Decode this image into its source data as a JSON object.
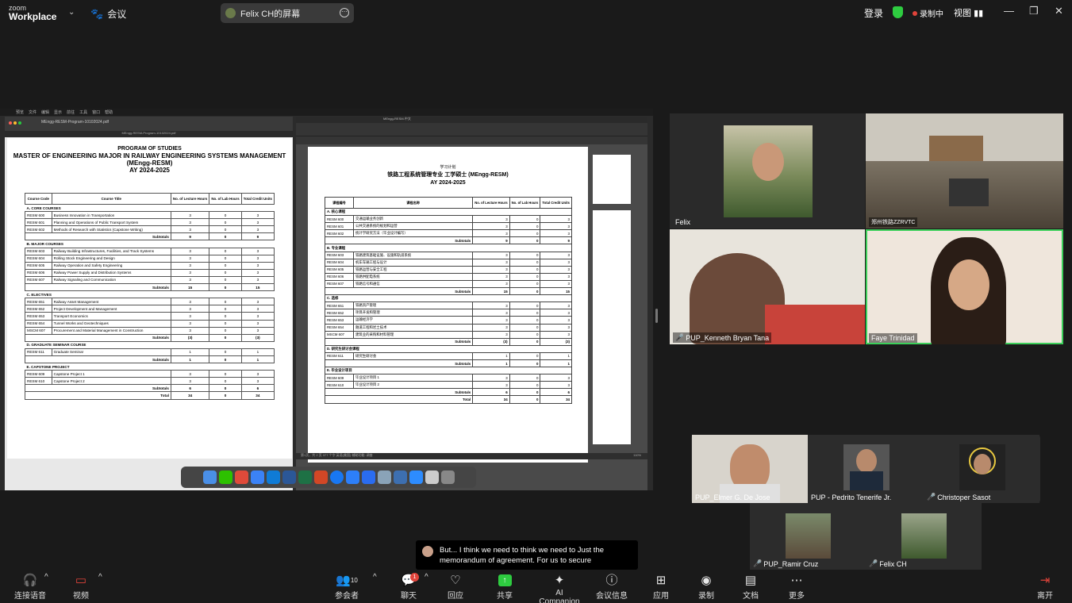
{
  "topbar": {
    "logo_line1": "zoom",
    "logo_line2": "Workplace",
    "meeting_label": "会议",
    "share_pill_label": "Felix CH的屏幕",
    "login": "登录",
    "recording": "录制中",
    "view": "视图"
  },
  "mac_menubar": [
    "预览",
    "文件",
    "编辑",
    "显示",
    "前往",
    "工具",
    "窗口",
    "帮助"
  ],
  "pdf": {
    "filename": "MEngg-RESM-Program-10102024.pdf",
    "tab": "MEngg-RESM-Program-10102024.pdf",
    "title1": "PROGRAM OF STUDIES",
    "title2": "MASTER OF ENGINEERING MAJOR IN RAILWAY ENGINEERING SYSTEMS MANAGEMENT",
    "title3": "(MEngg-RESM)",
    "title4": "AY 2024-2025",
    "headers": [
      "Course Code",
      "Course Title",
      "No. of Lecture Hours",
      "No. of Lab Hours",
      "Total Credit Units"
    ],
    "rows": [
      {
        "type": "sec",
        "cells": [
          "A.   CORE COURSES"
        ]
      },
      {
        "type": "row",
        "cells": [
          "RESM 600",
          "Business Innovation in Transportation",
          "3",
          "0",
          "3"
        ]
      },
      {
        "type": "row",
        "cells": [
          "RESM 601",
          "Planning and Operations of Public Transport System",
          "3",
          "0",
          "3"
        ]
      },
      {
        "type": "row",
        "cells": [
          "RESM 602",
          "Methods of Research with Statistics (Capstone Writing)",
          "3",
          "0",
          "3"
        ]
      },
      {
        "type": "sub",
        "cells": [
          "Subtotals",
          "9",
          "0",
          "9"
        ]
      },
      {
        "type": "sec",
        "cells": [
          "B.   MAJOR COURSES"
        ]
      },
      {
        "type": "row",
        "cells": [
          "RESM 603",
          "Railway Building Infrastructures, Facilities, and Track Systems",
          "3",
          "0",
          "3"
        ]
      },
      {
        "type": "row",
        "cells": [
          "RESM 604",
          "Rolling Stock Engineering and Design",
          "3",
          "0",
          "3"
        ]
      },
      {
        "type": "row",
        "cells": [
          "RESM 605",
          "Railway Operation and Safety Engineering",
          "3",
          "0",
          "3"
        ]
      },
      {
        "type": "row",
        "cells": [
          "RESM 606",
          "Railway Power Supply and Distribution Systems",
          "3",
          "0",
          "3"
        ]
      },
      {
        "type": "row",
        "cells": [
          "RESM 607",
          "Railway Signaling and Communication",
          "3",
          "0",
          "3"
        ]
      },
      {
        "type": "sub",
        "cells": [
          "Subtotals",
          "15",
          "0",
          "15"
        ]
      },
      {
        "type": "sec",
        "cells": [
          "C.   ELECTIVES"
        ]
      },
      {
        "type": "row",
        "cells": [
          "RESM 651",
          "Railway Asset Management",
          "3",
          "0",
          "3"
        ]
      },
      {
        "type": "row",
        "cells": [
          "RESM 652",
          "Project Development and Management",
          "3",
          "0",
          "3"
        ]
      },
      {
        "type": "row",
        "cells": [
          "RESM 653",
          "Transport Economics",
          "3",
          "0",
          "3"
        ]
      },
      {
        "type": "row",
        "cells": [
          "RESM 654",
          "Tunnel Works and Geotechniques",
          "3",
          "0",
          "3"
        ]
      },
      {
        "type": "row",
        "cells": [
          "MSCM 607",
          "Procurement and Material Management in Construction",
          "3",
          "0",
          "3"
        ]
      },
      {
        "type": "sub",
        "cells": [
          "Subtotals",
          "(3)",
          "0",
          "(3)"
        ]
      },
      {
        "type": "sec",
        "cells": [
          "D.   GRADUATE SEMINAR COURSE"
        ]
      },
      {
        "type": "row",
        "cells": [
          "RESM 611",
          "Graduate Seminar",
          "1",
          "0",
          "1"
        ]
      },
      {
        "type": "sub",
        "cells": [
          "Subtotals",
          "1",
          "0",
          "1"
        ]
      },
      {
        "type": "sec",
        "cells": [
          "E.   CAPSTONE PROJECT"
        ]
      },
      {
        "type": "row",
        "cells": [
          "RESM 609",
          "Capstone Project 1",
          "3",
          "0",
          "3"
        ]
      },
      {
        "type": "row",
        "cells": [
          "RESM 610",
          "Capstone Project 2",
          "3",
          "0",
          "3"
        ]
      },
      {
        "type": "sub",
        "cells": [
          "Subtotals",
          "6",
          "0",
          "6"
        ]
      },
      {
        "type": "sub",
        "cells": [
          "Total",
          "34",
          "0",
          "34"
        ]
      }
    ]
  },
  "word": {
    "titlebar": "MEngg-RESM-中文",
    "status": "第1页，共 2 页    377 个字    英语(美国)    辅助功能: 调查",
    "zoom": "110%",
    "title1": "学习计划",
    "title2": "铁路工程系统管理专业 工学硕士 (MEngg-RESM)",
    "title3": "AY 2024-2025",
    "headers": [
      "课程编号",
      "课程名称",
      "No. of Lecture Hours",
      "No. of Lab Hours",
      "Total Credit Units"
    ],
    "rows": [
      {
        "type": "sec",
        "cells": [
          "A.  核心课程"
        ]
      },
      {
        "type": "row",
        "cells": [
          "RESM 600",
          "交通运输业务创新",
          "3",
          "0",
          "3"
        ]
      },
      {
        "type": "row",
        "cells": [
          "RESM 601",
          "公共交通系统的规划和运营",
          "3",
          "0",
          "3"
        ]
      },
      {
        "type": "row",
        "cells": [
          "RESM 602",
          "统计学研究方法（毕业设计编写）",
          "3",
          "0",
          "3"
        ]
      },
      {
        "type": "sub",
        "cells": [
          "Subtotals",
          "9",
          "0",
          "9"
        ]
      },
      {
        "type": "sec",
        "cells": [
          "B.  专业课程"
        ]
      },
      {
        "type": "row",
        "cells": [
          "RESM 603",
          "铁路建筑基础设施、设施和轨道系统",
          "3",
          "0",
          "3"
        ]
      },
      {
        "type": "row",
        "cells": [
          "RESM 604",
          "机车车辆工程与设计",
          "3",
          "0",
          "3"
        ]
      },
      {
        "type": "row",
        "cells": [
          "RESM 605",
          "铁路运营与安全工程",
          "3",
          "0",
          "3"
        ]
      },
      {
        "type": "row",
        "cells": [
          "RESM 606",
          "铁路供配电系统",
          "3",
          "0",
          "3"
        ]
      },
      {
        "type": "row",
        "cells": [
          "RESM 607",
          "铁路信号和通信",
          "3",
          "0",
          "3"
        ]
      },
      {
        "type": "sub",
        "cells": [
          "Subtotals",
          "15",
          "0",
          "15"
        ]
      },
      {
        "type": "sec",
        "cells": [
          "C.  选修"
        ]
      },
      {
        "type": "row",
        "cells": [
          "RESM 651",
          "铁路资产管理",
          "3",
          "0",
          "3"
        ]
      },
      {
        "type": "row",
        "cells": [
          "RESM 652",
          "项目开发和管理",
          "3",
          "0",
          "3"
        ]
      },
      {
        "type": "row",
        "cells": [
          "RESM 653",
          "运输经济学",
          "3",
          "0",
          "3"
        ]
      },
      {
        "type": "row",
        "cells": [
          "RESM 654",
          "隧道工程和岩土技术",
          "3",
          "0",
          "3"
        ]
      },
      {
        "type": "row",
        "cells": [
          "MSCM 607",
          "建筑业的采购和材料管理",
          "3",
          "0",
          "3"
        ]
      },
      {
        "type": "sub",
        "cells": [
          "Subtotals",
          "(3)",
          "0",
          "(3)"
        ]
      },
      {
        "type": "sec",
        "cells": [
          "D.  研究生研讨会课程"
        ]
      },
      {
        "type": "row",
        "cells": [
          "RESM 611",
          "研究生研讨会",
          "1",
          "0",
          "1"
        ]
      },
      {
        "type": "sub",
        "cells": [
          "Subtotals",
          "1",
          "0",
          "1"
        ]
      },
      {
        "type": "sec",
        "cells": [
          "E.  毕业设计项目"
        ]
      },
      {
        "type": "row",
        "cells": [
          "RESM 609",
          "毕业设计项目 1",
          "3",
          "0",
          "3"
        ]
      },
      {
        "type": "row",
        "cells": [
          "RESM 610",
          "毕业设计项目 2",
          "3",
          "0",
          "3"
        ]
      },
      {
        "type": "sub",
        "cells": [
          "Subtotals",
          "6",
          "0",
          "6"
        ]
      },
      {
        "type": "sub",
        "cells": [
          "Total",
          "34",
          "0",
          "34"
        ]
      }
    ]
  },
  "participants": {
    "felix": "Felix",
    "room": "郑州铁路ZZRVTC",
    "kenneth": "PUP_Kenneth Bryan Tana",
    "faye": "Faye Trinidad",
    "elmer": "PUP_Elmer G. De Jose",
    "pedrito": "PUP - Pedrito Tenerife Jr.",
    "christoper": "Christoper Sasot",
    "ramir": "PUP_Ramir Cruz",
    "felixch": "Felix CH"
  },
  "caption": {
    "text": "But... I think we need to think we need to Just the memorandum of agreement. For us to secure"
  },
  "toolbar": {
    "audio": "连接语音",
    "video": "视频",
    "participants": "参会者",
    "participants_count": "10",
    "chat": "聊天",
    "chat_badge": "1",
    "react": "回应",
    "share": "共享",
    "ai": "AI Companion",
    "info": "会议信息",
    "apps": "应用",
    "record": "录制",
    "docs": "文档",
    "more": "更多",
    "leave": "离开"
  }
}
